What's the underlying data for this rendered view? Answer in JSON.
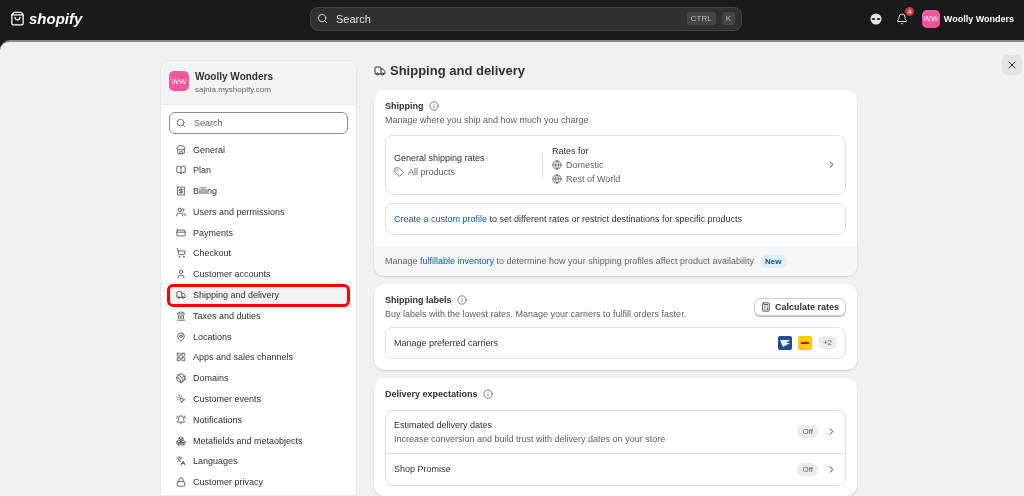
{
  "topbar": {
    "logo": "shopify",
    "search": {
      "placeholder": "Search",
      "keys": [
        "CTRL",
        "K"
      ]
    },
    "notifications": "4",
    "store": {
      "initials": "WW",
      "name": "Woolly Wonders"
    }
  },
  "sidebar": {
    "store_initials": "WW",
    "store_name": "Woolly Wonders",
    "store_url": "sajnia.myshopify.com",
    "search": {
      "placeholder": "Search"
    },
    "items": [
      {
        "label": "General",
        "selected": false
      },
      {
        "label": "Plan",
        "selected": false
      },
      {
        "label": "Billing",
        "selected": false
      },
      {
        "label": "Users and permissions",
        "selected": false
      },
      {
        "label": "Payments",
        "selected": false
      },
      {
        "label": "Checkout",
        "selected": false
      },
      {
        "label": "Customer accounts",
        "selected": false
      },
      {
        "label": "Shipping and delivery",
        "selected": true
      },
      {
        "label": "Taxes and duties",
        "selected": false
      },
      {
        "label": "Locations",
        "selected": false
      },
      {
        "label": "Apps and sales channels",
        "selected": false
      },
      {
        "label": "Domains",
        "selected": false
      },
      {
        "label": "Customer events",
        "selected": false
      },
      {
        "label": "Notifications",
        "selected": false
      },
      {
        "label": "Metafields and metaobjects",
        "selected": false
      },
      {
        "label": "Languages",
        "selected": false
      },
      {
        "label": "Customer privacy",
        "selected": false
      }
    ]
  },
  "page_title": "Shipping and delivery",
  "shipping": {
    "title": "Shipping",
    "subtitle": "Manage where you ship and how much you charge",
    "rates_title": "General shipping rates",
    "rates_products": "All products",
    "rates_for_label": "Rates for",
    "zones": [
      "Domestic",
      "Rest of World"
    ],
    "custom_profile": {
      "link": "Create a custom profile",
      "text": " to set different rates or restrict destinations for specific products"
    },
    "footer": {
      "before": "Manage ",
      "link": "fulfillable inventory",
      "after": " to determine how your shipping profiles affect product availability",
      "badge": "New"
    }
  },
  "shipping_labels": {
    "title": "Shipping labels",
    "subtitle": "Buy labels with the lowest rates. Manage your carriers to fulfill orders faster.",
    "button": "Calculate rates",
    "carriers_label": "Manage preferred carriers",
    "more_carriers": "+2"
  },
  "delivery_expectations": {
    "title": "Delivery expectations",
    "rows": [
      {
        "title": "Estimated delivery dates",
        "subtitle": "Increase conversion and build trust with delivery dates on your store",
        "status": "Off"
      },
      {
        "title": "Shop Promise",
        "status": "Off"
      }
    ]
  }
}
